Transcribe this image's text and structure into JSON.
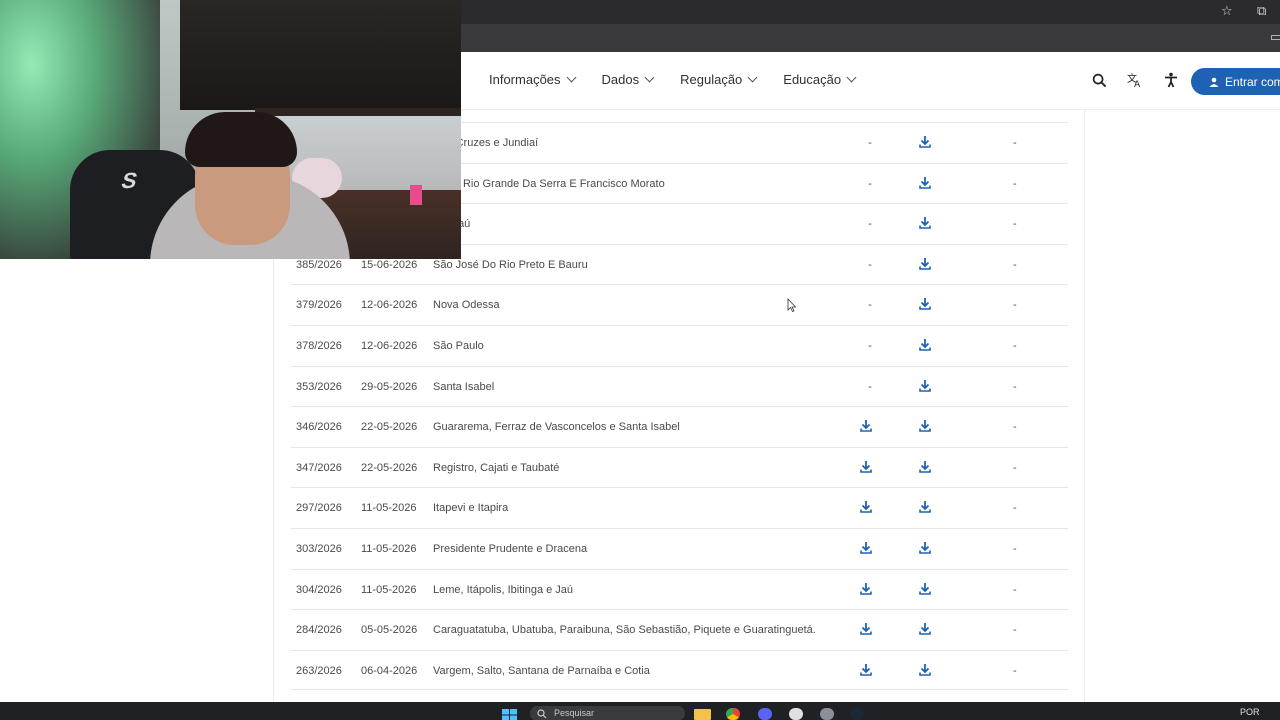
{
  "browser": {
    "star_icon": "star-icon",
    "extensions_icon": "puzzle-icon"
  },
  "nav": {
    "items": [
      {
        "label": "Informações"
      },
      {
        "label": "Dados"
      },
      {
        "label": "Regulação"
      },
      {
        "label": "Educação"
      }
    ],
    "login_label": "Entrar com",
    "icons": [
      "search-icon",
      "translate-icon",
      "accessibility-icon"
    ]
  },
  "table": {
    "rows": [
      {
        "num": "",
        "date": "",
        "cities": "Das Cruzes e Jundiaí",
        "col1": "-",
        "col3": "-"
      },
      {
        "num": "",
        "date": "",
        "cities": "cana, Rio Grande Da Serra E Francisco Morato",
        "col1": "-",
        "col3": "-"
      },
      {
        "num": "",
        "date": "",
        "cities": "a E Jaú",
        "col1": "-",
        "col3": "-"
      },
      {
        "num": "385/2026",
        "date": "15-06-2026",
        "cities": "São José Do Rio Preto E Bauru",
        "col1": "-",
        "col3": "-"
      },
      {
        "num": "379/2026",
        "date": "12-06-2026",
        "cities": "Nova Odessa",
        "col1": "-",
        "col3": "-"
      },
      {
        "num": "378/2026",
        "date": "12-06-2026",
        "cities": "São Paulo",
        "col1": "-",
        "col3": "-"
      },
      {
        "num": "353/2026",
        "date": "29-05-2026",
        "cities": "Santa Isabel",
        "col1": "-",
        "col3": "-"
      },
      {
        "num": "346/2026",
        "date": "22-05-2026",
        "cities": "Guararema, Ferraz de Vasconcelos e Santa Isabel",
        "col1": "download",
        "col3": "-"
      },
      {
        "num": "347/2026",
        "date": "22-05-2026",
        "cities": "Registro, Cajati e Taubaté",
        "col1": "download",
        "col3": "-"
      },
      {
        "num": "297/2026",
        "date": "11-05-2026",
        "cities": "Itapevi e Itapira",
        "col1": "download",
        "col3": "-"
      },
      {
        "num": "303/2026",
        "date": "11-05-2026",
        "cities": "Presidente Prudente e Dracena",
        "col1": "download",
        "col3": "-"
      },
      {
        "num": "304/2026",
        "date": "11-05-2026",
        "cities": "Leme, Itápolis, Ibitinga e Jaú",
        "col1": "download",
        "col3": "-"
      },
      {
        "num": "284/2026",
        "date": "05-05-2026",
        "cities": "Caraguatatuba, Ubatuba, Paraibuna, São Sebastião, Piquete e Guaratinguetá.",
        "col1": "download",
        "col3": "-"
      },
      {
        "num": "263/2026",
        "date": "06-04-2026",
        "cities": "Vargem, Salto, Santana de Parnaíba e Cotia",
        "col1": "download",
        "col3": "-"
      }
    ]
  },
  "taskbar": {
    "search_placeholder": "Pesquisar",
    "language": "POR"
  },
  "colors": {
    "accent": "#1e62b5",
    "download_icon": "#1e62b5"
  }
}
